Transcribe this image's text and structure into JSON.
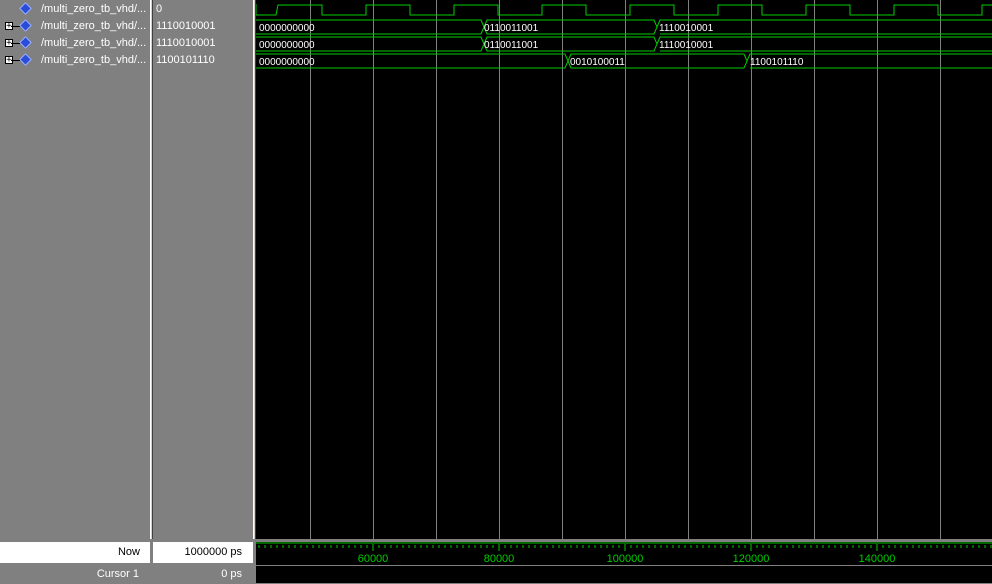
{
  "signals": [
    {
      "name": "/multi_zero_tb_vhd/...",
      "value": "0",
      "expandable": false,
      "kind": "clock"
    },
    {
      "name": "/multi_zero_tb_vhd/...",
      "value": "1110010001",
      "expandable": true,
      "kind": "bus",
      "segments": [
        "0000000000",
        "0110011001",
        "1110010001"
      ]
    },
    {
      "name": "/multi_zero_tb_vhd/...",
      "value": "1110010001",
      "expandable": true,
      "kind": "bus",
      "segments": [
        "0000000000",
        "0110011001",
        "1110010001"
      ]
    },
    {
      "name": "/multi_zero_tb_vhd/...",
      "value": "1100101110",
      "expandable": true,
      "kind": "bus",
      "segments": [
        "0000000000",
        "0010100011",
        "1100101110"
      ]
    }
  ],
  "status": {
    "now_label": "Now",
    "now_value": "1000000 ps",
    "cursor_label": "Cursor 1",
    "cursor_value": "0 ps"
  },
  "timeline": {
    "tick_labels": [
      "60000",
      "80000",
      "100000",
      "120000",
      "140000"
    ],
    "tick_values": [
      60000,
      80000,
      100000,
      120000,
      140000
    ]
  },
  "colors": {
    "wave": "#00cc00",
    "grid": "#808080",
    "background": "#000000",
    "axis_text": "#00cc00"
  }
}
